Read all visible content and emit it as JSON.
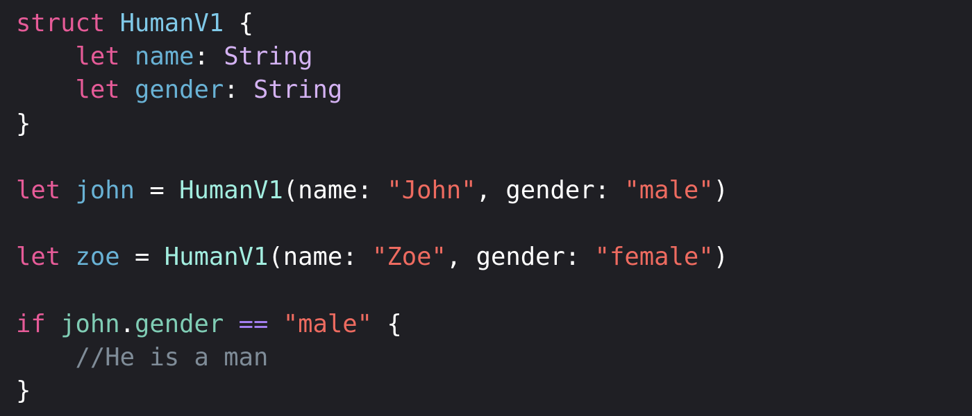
{
  "colors": {
    "background": "#1f1f24",
    "keyword": "#e65b98",
    "type_declaration": "#80c9e8",
    "variable_declaration": "#69b2d5",
    "member_access": "#80cdb5",
    "type_name": "#d4b2f3",
    "call_type": "#a3eee0",
    "string": "#ee6b60",
    "operator": "#a27ef0",
    "comment": "#7f8c98",
    "plain": "#ffffff"
  },
  "code": {
    "lines": [
      [
        {
          "text": "struct",
          "role": "keyword"
        },
        {
          "text": " ",
          "role": "plain"
        },
        {
          "text": "HumanV1",
          "role": "type_declaration"
        },
        {
          "text": " {",
          "role": "plain"
        }
      ],
      [
        {
          "text": "    ",
          "role": "plain"
        },
        {
          "text": "let",
          "role": "keyword"
        },
        {
          "text": " ",
          "role": "plain"
        },
        {
          "text": "name",
          "role": "variable_declaration"
        },
        {
          "text": ": ",
          "role": "plain"
        },
        {
          "text": "String",
          "role": "type_name"
        }
      ],
      [
        {
          "text": "    ",
          "role": "plain"
        },
        {
          "text": "let",
          "role": "keyword"
        },
        {
          "text": " ",
          "role": "plain"
        },
        {
          "text": "gender",
          "role": "variable_declaration"
        },
        {
          "text": ": ",
          "role": "plain"
        },
        {
          "text": "String",
          "role": "type_name"
        }
      ],
      [
        {
          "text": "}",
          "role": "plain"
        }
      ],
      [],
      [
        {
          "text": "let",
          "role": "keyword"
        },
        {
          "text": " ",
          "role": "plain"
        },
        {
          "text": "john",
          "role": "variable_declaration"
        },
        {
          "text": " = ",
          "role": "plain"
        },
        {
          "text": "HumanV1",
          "role": "call_type"
        },
        {
          "text": "(name: ",
          "role": "plain"
        },
        {
          "text": "\"John\"",
          "role": "string"
        },
        {
          "text": ", gender: ",
          "role": "plain"
        },
        {
          "text": "\"male\"",
          "role": "string"
        },
        {
          "text": ")",
          "role": "plain"
        }
      ],
      [],
      [
        {
          "text": "let",
          "role": "keyword"
        },
        {
          "text": " ",
          "role": "plain"
        },
        {
          "text": "zoe",
          "role": "variable_declaration"
        },
        {
          "text": " = ",
          "role": "plain"
        },
        {
          "text": "HumanV1",
          "role": "call_type"
        },
        {
          "text": "(name: ",
          "role": "plain"
        },
        {
          "text": "\"Zoe\"",
          "role": "string"
        },
        {
          "text": ", gender: ",
          "role": "plain"
        },
        {
          "text": "\"female\"",
          "role": "string"
        },
        {
          "text": ")",
          "role": "plain"
        }
      ],
      [],
      [
        {
          "text": "if",
          "role": "keyword"
        },
        {
          "text": " ",
          "role": "plain"
        },
        {
          "text": "john",
          "role": "member_access"
        },
        {
          "text": ".",
          "role": "plain"
        },
        {
          "text": "gender",
          "role": "member_access"
        },
        {
          "text": " ",
          "role": "plain"
        },
        {
          "text": "==",
          "role": "operator"
        },
        {
          "text": " ",
          "role": "plain"
        },
        {
          "text": "\"male\"",
          "role": "string"
        },
        {
          "text": " {",
          "role": "plain"
        }
      ],
      [
        {
          "text": "    ",
          "role": "plain"
        },
        {
          "text": "//He is a man",
          "role": "comment"
        }
      ],
      [
        {
          "text": "}",
          "role": "plain"
        }
      ]
    ]
  }
}
